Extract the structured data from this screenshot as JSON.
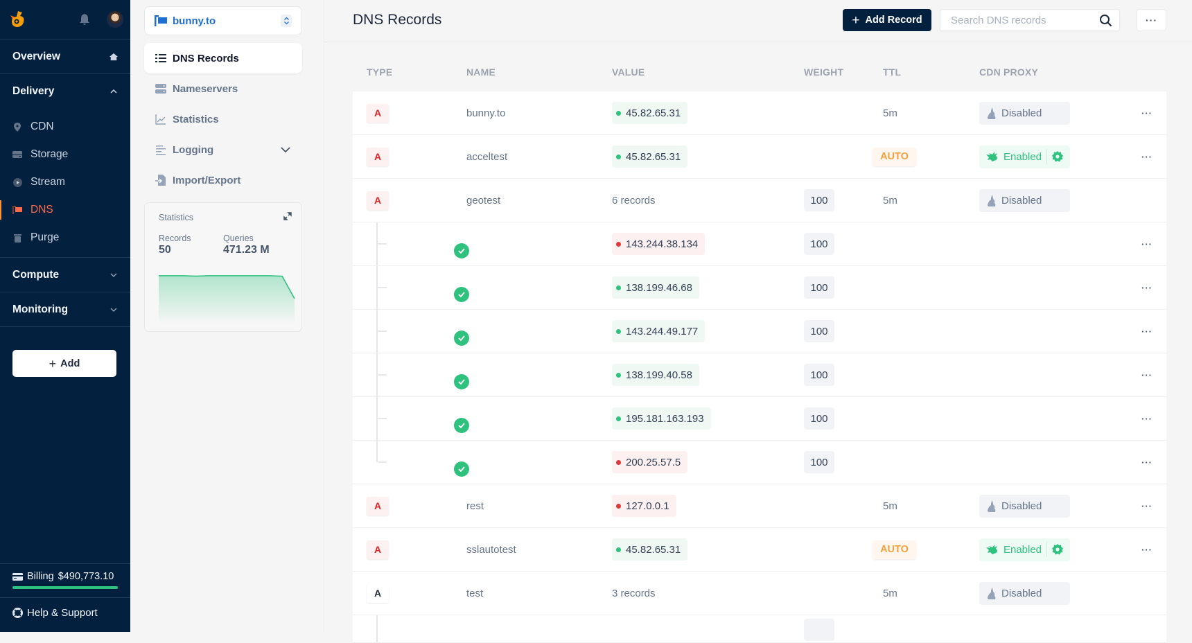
{
  "sidebar": {
    "overview": "Overview",
    "delivery": "Delivery",
    "delivery_items": [
      {
        "label": "CDN",
        "icon": "map-pin-icon"
      },
      {
        "label": "Storage",
        "icon": "drive-icon"
      },
      {
        "label": "Stream",
        "icon": "play-circle-icon"
      },
      {
        "label": "DNS",
        "icon": "flag-icon",
        "active": true
      },
      {
        "label": "Purge",
        "icon": "trash-icon"
      }
    ],
    "compute": "Compute",
    "monitoring": "Monitoring",
    "add_label": "Add",
    "billing_label": "Billing",
    "billing_amount": "$490,773.10",
    "billing_progress_pct": 100,
    "help_label": "Help & Support"
  },
  "panel": {
    "zone": "bunny.to",
    "nav": [
      {
        "label": "DNS Records",
        "active": true
      },
      {
        "label": "Nameservers"
      },
      {
        "label": "Statistics"
      },
      {
        "label": "Logging",
        "expandable": true
      },
      {
        "label": "Import/Export"
      }
    ],
    "stats": {
      "title": "Statistics",
      "records_label": "Records",
      "records_value": "50",
      "queries_label": "Queries",
      "queries_value": "471.23 M",
      "sparkline": [
        0.96,
        0.96,
        0.96,
        0.95,
        0.96,
        0.96,
        0.96,
        0.96,
        0.96,
        0.96,
        0.95,
        0.5
      ]
    }
  },
  "main": {
    "title": "DNS Records",
    "add_record": "Add Record",
    "search_placeholder": "Search DNS records",
    "columns": [
      "TYPE",
      "NAME",
      "VALUE",
      "WEIGHT",
      "TTL",
      "CDN PROXY"
    ],
    "rows": [
      {
        "kind": "record",
        "type": "A",
        "type_style": "red",
        "name": "bunny.to",
        "value": "45.82.65.31",
        "value_status": "ok",
        "weight": "",
        "ttl": "5m",
        "ttl_auto": false,
        "cdn": "Disabled",
        "cdn_enabled": false,
        "more": true
      },
      {
        "kind": "record",
        "type": "A",
        "type_style": "red",
        "name": "acceltest",
        "value": "45.82.65.31",
        "value_status": "ok",
        "weight": "",
        "ttl": "AUTO",
        "ttl_auto": true,
        "cdn": "Enabled",
        "cdn_enabled": true,
        "more": true
      },
      {
        "kind": "record",
        "type": "A",
        "type_style": "red",
        "name": "geotest",
        "value": "6 records",
        "value_status": "group",
        "weight": "100",
        "ttl": "5m",
        "ttl_auto": false,
        "cdn": "Disabled",
        "cdn_enabled": false,
        "more": false
      },
      {
        "kind": "child",
        "enabled": true,
        "value": "143.244.38.134",
        "value_status": "bad",
        "weight": "100",
        "more": true
      },
      {
        "kind": "child",
        "enabled": true,
        "value": "138.199.46.68",
        "value_status": "ok",
        "weight": "100",
        "more": true
      },
      {
        "kind": "child",
        "enabled": true,
        "value": "143.244.49.177",
        "value_status": "ok",
        "weight": "100",
        "more": true
      },
      {
        "kind": "child",
        "enabled": true,
        "value": "138.199.40.58",
        "value_status": "ok",
        "weight": "100",
        "more": true
      },
      {
        "kind": "child",
        "enabled": true,
        "value": "195.181.163.193",
        "value_status": "ok",
        "weight": "100",
        "more": true
      },
      {
        "kind": "child",
        "enabled": true,
        "value": "200.25.57.5",
        "value_status": "bad",
        "weight": "100",
        "more": true,
        "last": true
      },
      {
        "kind": "record",
        "type": "A",
        "type_style": "red",
        "name": "rest",
        "value": "127.0.0.1",
        "value_status": "bad",
        "weight": "",
        "ttl": "5m",
        "ttl_auto": false,
        "cdn": "Disabled",
        "cdn_enabled": false,
        "more": true
      },
      {
        "kind": "record",
        "type": "A",
        "type_style": "red",
        "name": "sslautotest",
        "value": "45.82.65.31",
        "value_status": "ok",
        "weight": "",
        "ttl": "AUTO",
        "ttl_auto": true,
        "cdn": "Enabled",
        "cdn_enabled": true,
        "more": true
      },
      {
        "kind": "record",
        "type": "A",
        "type_style": "plain",
        "name": "test",
        "value": "3 records",
        "value_status": "group",
        "weight": "",
        "ttl": "5m",
        "ttl_auto": false,
        "cdn": "Disabled",
        "cdn_enabled": false,
        "more": false
      },
      {
        "kind": "child",
        "enabled": true,
        "value": "",
        "value_status": "ok",
        "weight": "",
        "more": false,
        "partial": true
      }
    ]
  },
  "colors": {
    "sidebar_bg": "#04203f",
    "accent_active": "#fb6a4a",
    "ok": "#2ec27e",
    "bad": "#dc3a3a",
    "auto": "#f5a03c",
    "zone_link": "#1f6fd1"
  }
}
